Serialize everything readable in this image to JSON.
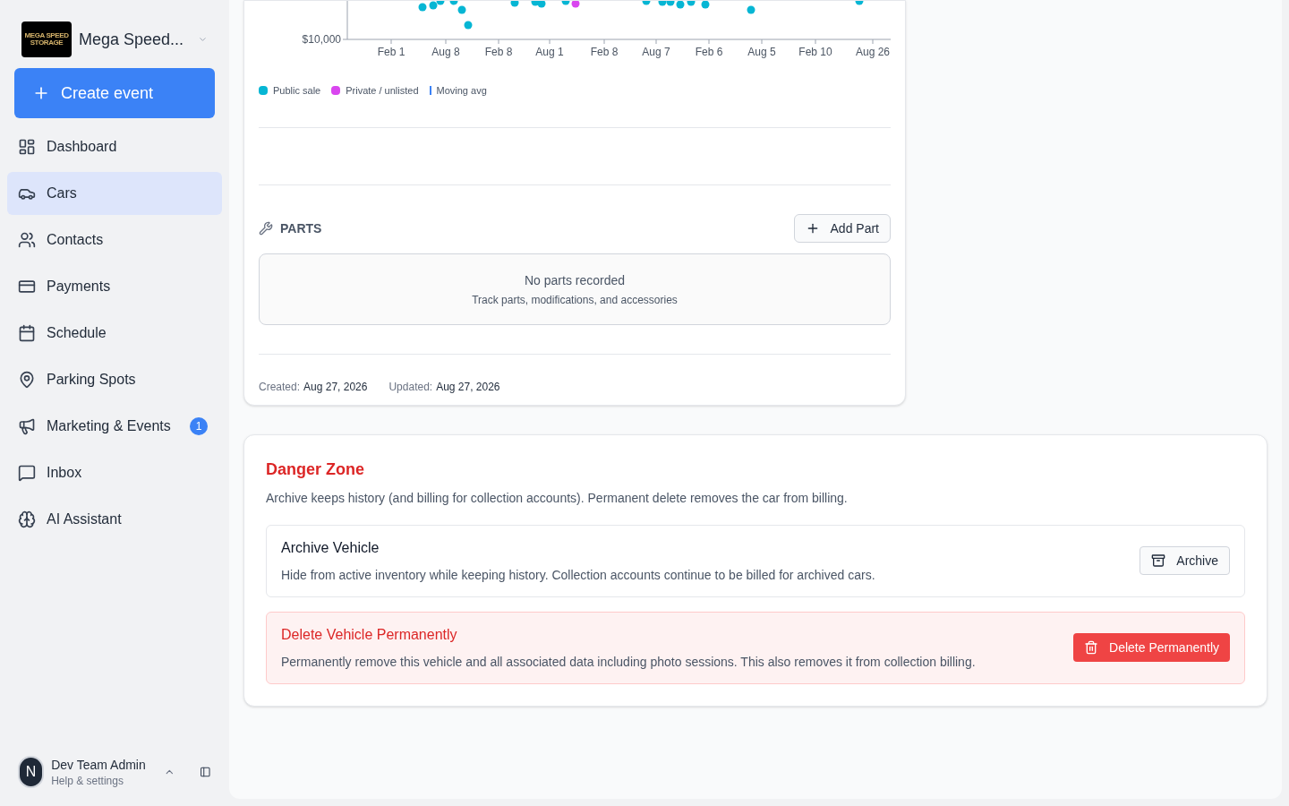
{
  "sidebar": {
    "workspace": {
      "logo_lines": [
        "MEGA SPEED",
        "STORAGE"
      ],
      "name": "Mega Speed..."
    },
    "create_button": "Create event",
    "items": [
      {
        "kind": "dashboard",
        "label": "Dashboard",
        "selected": false
      },
      {
        "kind": "cars",
        "label": "Cars",
        "selected": true
      },
      {
        "kind": "contacts",
        "label": "Contacts",
        "selected": false
      },
      {
        "kind": "payments",
        "label": "Payments",
        "selected": false
      },
      {
        "kind": "schedule",
        "label": "Schedule",
        "selected": false
      },
      {
        "kind": "parking",
        "label": "Parking Spots",
        "selected": false
      },
      {
        "kind": "marketing",
        "label": "Marketing & Events",
        "selected": false,
        "badge": "1"
      },
      {
        "kind": "inbox",
        "label": "Inbox",
        "selected": false
      },
      {
        "kind": "ai",
        "label": "AI Assistant",
        "selected": false
      }
    ],
    "user": {
      "initial": "N",
      "name": "Dev Team Admin",
      "subtitle": "Help & settings"
    }
  },
  "price_chart": {
    "y_tick": "$10,000",
    "x_ticks": [
      "Feb 1",
      "Aug 8",
      "Feb 8",
      "Aug 1",
      "Feb 8",
      "Aug 7",
      "Feb 6",
      "Aug 5",
      "Feb 10",
      "Aug 26"
    ],
    "legend": [
      {
        "kind": "dot",
        "label": "Public sale",
        "color": "#06b6d4"
      },
      {
        "kind": "dot",
        "label": "Private / unlisted",
        "color": "#d946ef"
      },
      {
        "kind": "line",
        "label": "Moving avg",
        "color": "#3b82f6"
      }
    ]
  },
  "parts": {
    "title": "PARTS",
    "add_button": "Add Part",
    "empty_title": "No parts recorded",
    "empty_text": "Track parts, modifications, and accessories"
  },
  "meta": [
    {
      "label": "Created:",
      "value": "Aug 27, 2026"
    },
    {
      "label": "Updated:",
      "value": "Aug 27, 2026"
    }
  ],
  "danger_zone": {
    "title": "Danger Zone",
    "description": "Archive keeps history (and billing for collection accounts). Permanent delete removes the car from billing.",
    "actions": [
      {
        "kind": "archive",
        "title": "Archive Vehicle",
        "description": "Hide from active inventory while keeping history. Collection accounts continue to be billed for archived cars.",
        "button": "Archive"
      },
      {
        "kind": "delete",
        "title": "Delete Vehicle Permanently",
        "description": "Permanently remove this vehicle and all associated data including photo sessions. This also removes it from collection billing.",
        "button": "Delete Permanently"
      }
    ]
  }
}
